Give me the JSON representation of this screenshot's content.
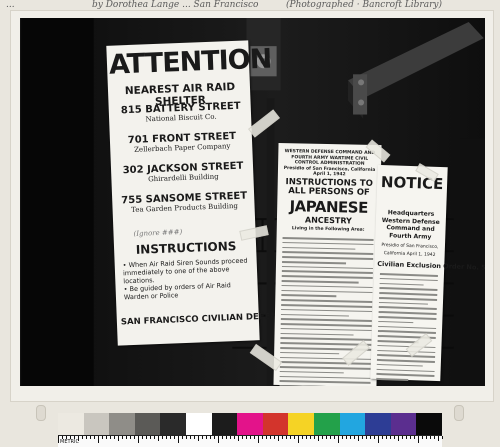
{
  "archive_notes": {
    "left": "...",
    "middle": "by Dorothea Lange ... San Francisco",
    "right": "(Photographed · Bancroft Library)"
  },
  "poster_attention": {
    "title": "ATTENTION",
    "subtitle": "NEAREST AIR RAID SHELTER",
    "addresses": [
      {
        "street": "815 BATTERY STREET",
        "place": "National Biscuit Co."
      },
      {
        "street": "701 FRONT STREET",
        "place": "Zellerbach Paper Company"
      },
      {
        "street": "302 JACKSON STREET",
        "place": "Ghirardelli Building"
      },
      {
        "street": "755 SANSOME STREET",
        "place": "Tea Garden Products Building"
      }
    ],
    "handwritten_note": "(Ignore ###)",
    "instructions_heading": "INSTRUCTIONS",
    "instructions": [
      "• When Air Raid Siren Sounds proceed immediately to one of the above locations.",
      "• Be guided by orders of Air Raid Warden or Police"
    ],
    "footer": "SAN FRANCISCO CIVILIAN DEFENSE CO"
  },
  "poster_instructions": {
    "header": "WESTERN DEFENSE COMMAND AND FOURTH ARMY WARTIME CIVIL CONTROL ADMINISTRATION",
    "header_sub": "Presidio of San Francisco, California April 1, 1942",
    "title": "INSTRUCTIONS TO ALL PERSONS OF",
    "highlight": "JAPANESE",
    "subtitle": "ANCESTRY",
    "living": "Living in the Following Area:"
  },
  "poster_notice": {
    "title": "NOTICE",
    "hq": "Headquarters Western Defense Command and Fourth Army",
    "presidio": "Presidio of San Francisco, California April 1, 1942",
    "order": "Civilian Exclusion Order No. 5"
  },
  "color_bar": {
    "swatches": [
      "#ece9e1",
      "#c9c6bf",
      "#8f8d88",
      "#5b5a57",
      "#2a2a2a",
      "#ffffff",
      "#1c1c1c",
      "#e3138a",
      "#d3342c",
      "#f5d325",
      "#23a14a",
      "#22a6e0",
      "#2d3d95",
      "#5b2e8f",
      "#0a0a0a"
    ],
    "ruler_label": "METRIC"
  }
}
